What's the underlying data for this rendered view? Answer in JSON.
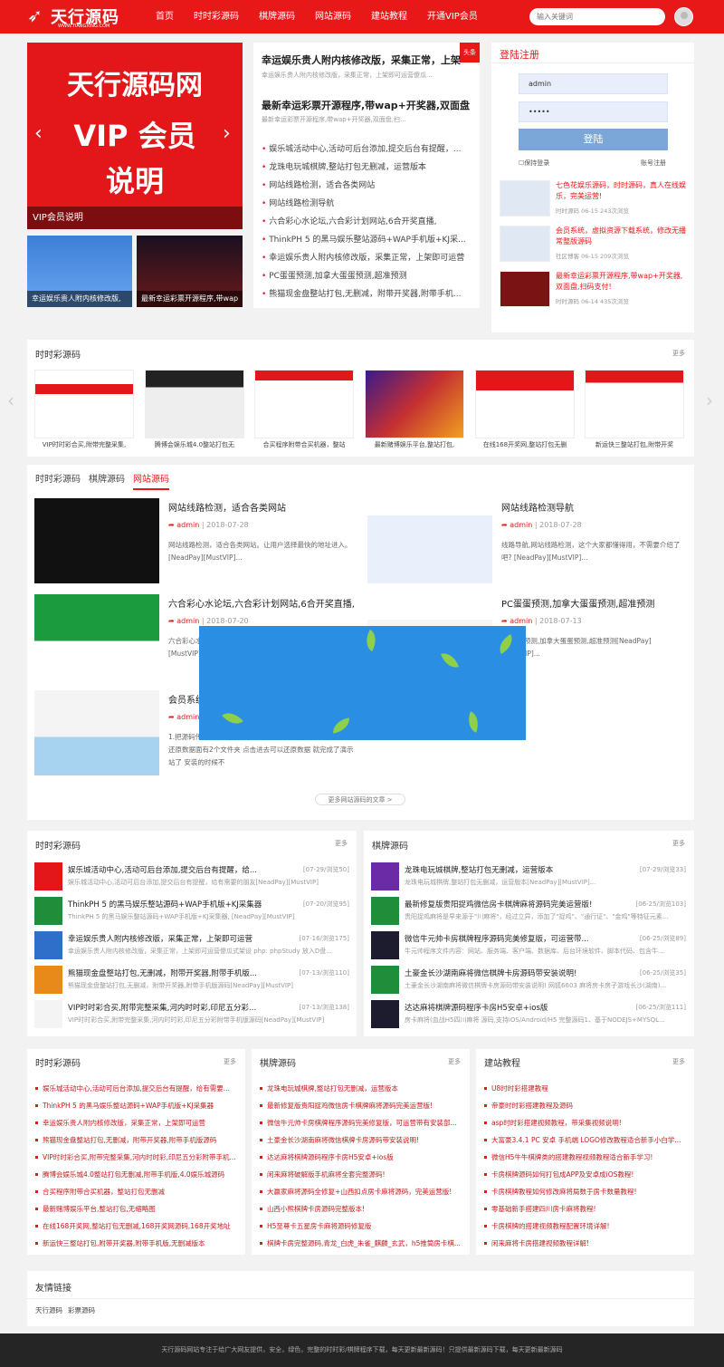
{
  "header": {
    "logo_text": "天行源码",
    "logo_url": "WWW.TIANGXING.COM",
    "nav": [
      "首页",
      "时时彩源码",
      "棋牌源码",
      "网站源码",
      "建站教程",
      "开通VIP会员"
    ],
    "search_placeholder": "输入关键词"
  },
  "banner": {
    "line1": "天行源码网",
    "line2": "VIP 会员",
    "line3": "说明",
    "caption": "VIP会员说明",
    "thumbs": [
      "幸运娱乐贵人附内核修改版,",
      "最新幸运彩票开源程序,带wap"
    ]
  },
  "news": {
    "ribbon": "头条",
    "headline1": "幸运娱乐贵人附内核修改版，采集正常，上架",
    "sub1": "幸运娱乐贵人附内核修改版，采集正常，上架即可运营傻瓜...",
    "headline2": "最新幸运彩票开源程序,带wap+开奖器,双面盘",
    "sub2": "最新幸运彩票开源程序,带wap+开奖器,双面盘,扫...",
    "items": [
      "娱乐城活动中心,活动可后台添加,提交后台有提醒，...",
      "龙珠电玩城棋牌,整站打包无删减，运营版本",
      "网站线路检测，适合各类网站",
      "网站线路检测导航",
      "六合彩心水论坛,六合彩计划网站,6合开奖直播,",
      "ThinkPH 5 的黑马娱乐整站源码+WAP手机版+KJ采...",
      "幸运娱乐贵人附内核修改版，采集正常，上架即可运营",
      "PC蛋蛋预测,加拿大蛋蛋预测,超准预测",
      "熊猫现金盘整站打包,无删减，附带开奖器,附带手机..."
    ]
  },
  "login": {
    "title": "登陆注册",
    "username": "admin",
    "password": "•••••",
    "button": "登陆",
    "remember": "保持登录",
    "register": "账号注册",
    "items": [
      {
        "title": "七色花娱乐源码，时时源码，真人在线娱乐，完美运营!",
        "meta": "时时源码   06-15   243次浏览"
      },
      {
        "title": "会员系统，虚拟资源下载系统，修改无播常整版源码",
        "meta": "社区博客   06-15   209次浏览"
      },
      {
        "title": "最新幸运彩票开源程序,带wap+开奖器,双面盘,扫码支付!",
        "meta": "时时源码   06-14   435次浏览"
      }
    ]
  },
  "carousel": {
    "title": "时时彩源码",
    "more": "更多",
    "items": [
      "VIP时时彩合买,附带完整采集,",
      "腾博会娱乐城4.0整站打包无",
      "合买程序附带合买机器，整站",
      "最新赌博娱乐平台,整站打包,",
      "在线168开奖网,整站打包无删",
      "新运快三整站打包,附带开奖"
    ]
  },
  "tabs": {
    "labels": [
      "时时彩源码",
      "棋牌源码",
      "网站源码"
    ],
    "author": "admin",
    "articles": [
      {
        "title": "网站线路检测，适合各类网站",
        "date": "2018-07-28",
        "desc": "网站线路检测，适合各类网站。让用户选择最快的地址进入。[NeadPay][MustVIP]..."
      },
      {
        "title": "网站线路检测导航",
        "date": "2018-07-28",
        "desc": "线路导航,网站线路检测，这个大家都懂得用，不需要介绍了吧? [NeadPay][MustVIP]..."
      },
      {
        "title": "六合彩心水论坛,六合彩计划网站,6合开奖直播,",
        "date": "2018-07-20",
        "desc": "六合彩心水论坛,六合彩计划网站,6合开奖直播,[NeadPay][MustVIP]..."
      },
      {
        "title": "PC蛋蛋预测,加拿大蛋蛋预测,超准预测",
        "date": "2018-07-13",
        "desc": "PC蛋蛋预测,加拿大蛋蛋预测,超准预测[NeadPay][MustVIP]..."
      },
      {
        "title": "会员系统，虚拟资源下载系统",
        "date": "2018-06-15",
        "desc": "1.把源码传到服务器... 安装完成后 进入后台-》数据库管理-》还原数据面有2个文件夹 点击进去可以还原数据 就完成了演示站了 安装的时候不"
      }
    ],
    "more_button": "更多网站源码的文章 >"
  },
  "list_left": {
    "title": "时时彩源码",
    "more": "更多",
    "items": [
      {
        "title": "娱乐城活动中心,活动可后台添加,提交后台有提醒，给...",
        "date": "[07-29/浏览50]",
        "desc": "娱乐城活动中心,活动可后台添加,提交后台有提醒，给有需要的朋友[NeadPay][MustVIP]"
      },
      {
        "title": "ThinkPH 5 的黑马娱乐整站源码+WAP手机版+KJ采集器",
        "date": "[07-20/浏览95]",
        "desc": "ThinkPH 5 的黑马娱乐整站源码+WAP手机版+KJ采集器, [NeadPay][MustVIP]"
      },
      {
        "title": "幸运娱乐贵人附内核修改版，采集正常，上架即可运营",
        "date": "[07-16/浏览175]",
        "desc": "幸运娱乐贵人附内核修改版，采集正常，上架即可运营傻瓜式架设 php: phpStudy 放入D盘..."
      },
      {
        "title": "熊猫现金盘整站打包,无删减，附带开奖器,附带手机版...",
        "date": "[07-13/浏览110]",
        "desc": "熊猫现金盘整站打包,无删减，附带开奖器,附带手机版源码[NeadPay][MustVIP]"
      },
      {
        "title": "VIP时时彩合买,附带完整采集,河内时时彩,印尼五分彩...",
        "date": "[07-13/浏览138]",
        "desc": "VIP时时彩合买,附带完整采集,河内时时彩,印尼五分彩附带手机版源码[NeadPay][MustVIP]"
      }
    ]
  },
  "list_right": {
    "title": "棋牌源码",
    "more": "更多",
    "items": [
      {
        "title": "龙珠电玩城棋牌,整站打包无删减，运营版本",
        "date": "[07-29/浏览33]",
        "desc": "龙珠电玩城棋牌,整站打包无删减，运营版本[NeadPay][MustVIP]..."
      },
      {
        "title": "最新修复版贵阳捉鸡微信房卡棋牌麻将源码完美运营版!",
        "date": "[06-25/浏览103]",
        "desc": "贵阳捉鸡麻将是早来源于\"川麻将\"，经过立异，添加了\"捉鸡\"、\"通行证\"、\"金鸡\"等特征元素..."
      },
      {
        "title": "微信牛元帅卡房棋牌程序源码完美修复版，可运营带...",
        "date": "[06-25/浏览89]",
        "desc": "牛元帅程序文件内容：网站、服务端、客户端、数据库、后台环境软件、脚本代码、包含牛..."
      },
      {
        "title": "土豪金长沙湖南麻将微信棋牌卡房源码带安装说明!",
        "date": "[06-25/浏览35]",
        "desc": "土豪金长沙湖南麻将微信棋牌卡房源码带安装说明! 网狐6603 麻将房卡房子游戏长沙(湖南)..."
      },
      {
        "title": "达达麻将棋牌源码程序卡房H5安卓+ios版",
        "date": "[06-25/浏览111]",
        "desc": "房卡麻将(血战H5四川麻将 源码,支持iOS/Android/H5 完整源码1、基于NODEJS+MYSQL..."
      }
    ]
  },
  "bottom_lists": [
    {
      "title": "时时彩源码",
      "more": "更多",
      "items": [
        "娱乐城活动中心,活动可后台添加,提交后台有提醒，给有需要...",
        "ThinkPH 5 的黑马娱乐整站源码+WAP手机版+KJ采集器",
        "幸运娱乐贵人附内核修改版，采集正常，上架即可运营",
        "熊猫现金盘整站打包,无删减，附带开奖器,附带手机版源码",
        "VIP时时彩合买,附带完整采集,河内时时彩,印尼五分彩附带手机...",
        "腾博会娱乐城4.0整站打包无删减,附带手机版,4.0娱乐城源码",
        "合买程序附带合买机器，整站打包无删减",
        "最新赌博娱乐平台,整站打包,无缩略图",
        "在线168开奖网,整站打包无删减,168开奖网源码,168开奖地址",
        "新运快三整站打包,附带开奖器,附带手机版,无删减版本"
      ]
    },
    {
      "title": "棋牌源码",
      "more": "更多",
      "items": [
        "龙珠电玩城棋牌,整站打包无删减，运营版本",
        "最新修复版贵阳捉鸡微信房卡棋牌麻将源码完美运营版!",
        "微信牛元帅卡房棋牌程序源码完美修复版，可运营带有安装部...",
        "土豪金长沙湖南麻将微信棋牌卡房源码带安装说明!",
        "达达麻将棋牌源码程序卡房H5安卓+ios版",
        "闲来麻将破解版手机麻将全套完整源码!",
        "大赢家麻将源码全修复+山西扣点房卡麻将源码，完美运营版!",
        "山西小熊棋牌卡房源码完整版本!",
        "H5至尊卡五星房卡麻将源码修复版",
        "棋牌卡房完整源码,青龙_白虎_朱雀_麒麟_玄武，h5推筒房卡棋..."
      ]
    },
    {
      "title": "建站教程",
      "more": "更多",
      "items": [
        "U8时时彩搭建教程",
        "帝豪时时彩搭建教程及源码",
        "asp时时彩搭建视频教程，带采集视频说明!",
        "大富豪3.4.1 PC 安卓 手机端 LOGO修改教程适合新手小白学...",
        "微信H5牛牛棋牌类的搭建教程视频教程适合新手学习!",
        "卡房棋牌源码如何打包成APP及安卓成iOS教程!",
        "卡房棋牌教程如何修改麻将局数于房卡数量教程!",
        "零基础新手搭建四川房卡麻将教程!",
        "卡房棋牌的搭建视频教程配置环境详解!",
        "闲来麻将卡房搭建视频教程详解!"
      ]
    }
  ],
  "links": {
    "title": "友情链接",
    "items": [
      "天行源码",
      "彩票源码"
    ]
  },
  "footer": "天行源码网站专注于给广大网友提供，安全，绿色，完整的时时彩/棋牌程序下载，每天更新最新源码！只提供最新源码下载，每天更新最新源码"
}
